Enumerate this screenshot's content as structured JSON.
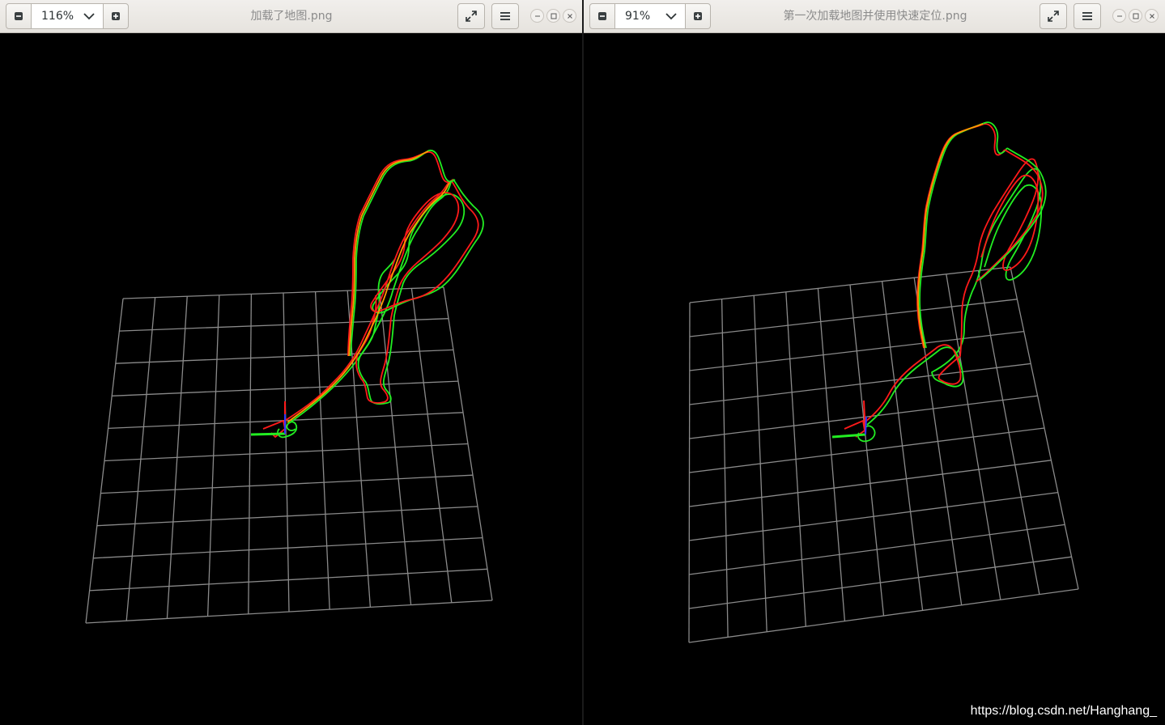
{
  "left": {
    "zoom": "116%",
    "title": "加载了地图.png",
    "buttons": {
      "zoom_out": "zoom-out",
      "zoom_in": "zoom-in",
      "fullscreen": "fullscreen",
      "menu": "menu"
    }
  },
  "right": {
    "zoom": "91%",
    "title": "第一次加载地图并使用快速定位.png",
    "buttons": {
      "zoom_out": "zoom-out",
      "zoom_in": "zoom-in",
      "fullscreen": "fullscreen",
      "menu": "menu"
    }
  },
  "watermark": "https://blog.csdn.net/Hanghang_",
  "colors": {
    "background": "#000000",
    "grid": "#8a8a8a",
    "trajectory_red": "#ff1a1a",
    "trajectory_green": "#22ee22",
    "trajectory_orange": "#ff9900",
    "axis_blue": "#3333ff"
  }
}
